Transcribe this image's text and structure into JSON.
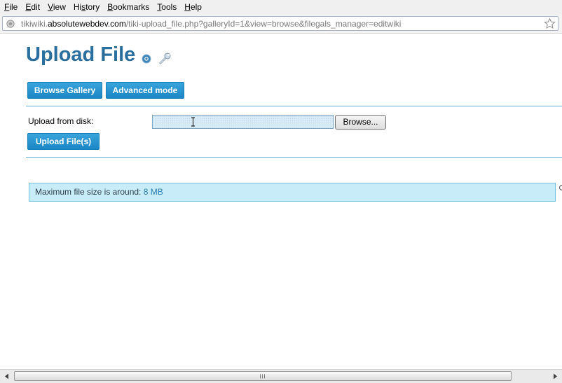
{
  "menu": [
    {
      "key": "F",
      "rest": "ile"
    },
    {
      "key": "E",
      "rest": "dit"
    },
    {
      "key": "V",
      "rest": "iew"
    },
    {
      "key": "",
      "pre": "Hi",
      "mid": "s",
      "post": "tory"
    },
    {
      "key": "B",
      "rest": "ookmarks"
    },
    {
      "key": "T",
      "rest": "ools"
    },
    {
      "key": "H",
      "rest": "elp"
    }
  ],
  "address": {
    "prefix": "tikiwiki.",
    "domain": "absolutewebdev.com",
    "path": "/tiki-upload_file.php?galleryId=1&view=browse&filegals_manager=editwiki"
  },
  "page": {
    "title": "Upload File",
    "browse_gallery_label": "Browse Gallery",
    "advanced_mode_label": "Advanced mode",
    "upload_from_disk_label": "Upload from disk:",
    "file_value": "",
    "browse_label": "Browse...",
    "upload_files_label": "Upload File(s)",
    "notice_text": "Maximum file size is around: ",
    "notice_size": "8 MB"
  },
  "icons": {
    "site": "page-icon",
    "bookmark": "star-icon",
    "help": "help-icon",
    "settings": "wrench-icon"
  },
  "colors": {
    "title": "#2a6f9e",
    "button": "#1a86c4",
    "notice_bg": "#c8ecf8",
    "rule": "#5aaed8"
  }
}
